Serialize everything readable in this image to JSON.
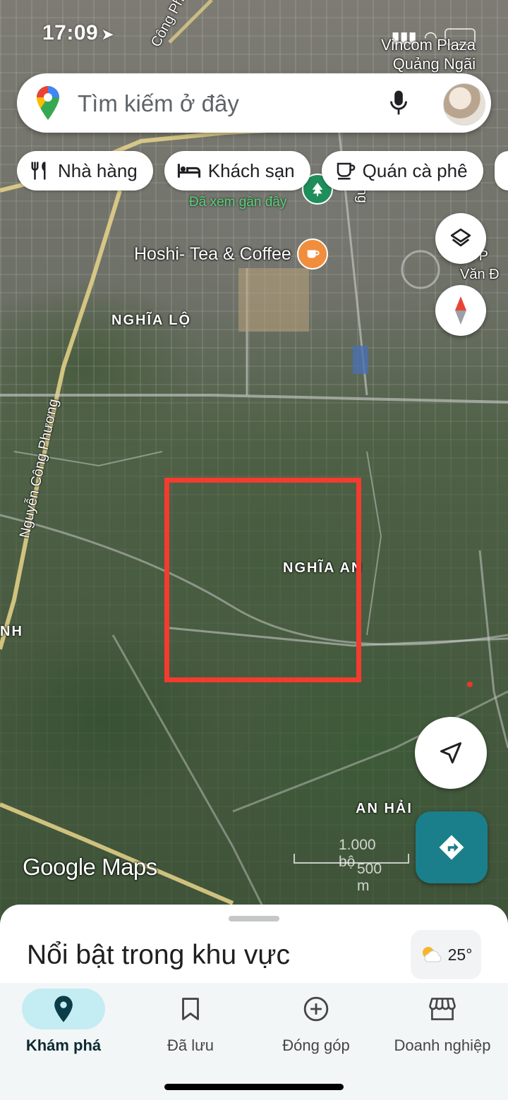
{
  "status_bar": {
    "time": "17:09"
  },
  "search": {
    "placeholder": "Tìm kiếm ở đây"
  },
  "chips": [
    {
      "label": "Nhà hàng",
      "icon": "restaurant-icon"
    },
    {
      "label": "Khách sạn",
      "icon": "hotel-icon"
    },
    {
      "label": "Quán cà phê",
      "icon": "coffee-icon"
    }
  ],
  "map": {
    "labels": {
      "vincom": "Vincom Plaza\nQuảng Ngãi",
      "nghia_lo": "NGHĨA LỘ",
      "nghia_an": "NGHĨA AN",
      "an_hai": "AN HẢI",
      "road_ncp": "Nguyễn Công Phương",
      "road_ncp_top": "Công Phương",
      "road_phung": "Phùng",
      "partial_nh": "NH",
      "partial_van": "ọc P\nVăn Đ"
    },
    "poi": {
      "name": "Hoshi- Tea & Coffee",
      "seen_text": "Đã xem gần đây"
    },
    "scale": {
      "ft": "1.000 bộ",
      "m": "500 m"
    },
    "attribution": "Google Maps",
    "highlight_color": "#f33b2f"
  },
  "sheet": {
    "title": "Nổi bật trong khu vực",
    "weather": "25°"
  },
  "nav": [
    {
      "label": "Khám phá",
      "icon": "explore-pin-icon",
      "active": true
    },
    {
      "label": "Đã lưu",
      "icon": "bookmark-icon",
      "active": false
    },
    {
      "label": "Đóng góp",
      "icon": "add-circle-icon",
      "active": false
    },
    {
      "label": "Doanh nghiệp",
      "icon": "storefront-icon",
      "active": false
    }
  ]
}
